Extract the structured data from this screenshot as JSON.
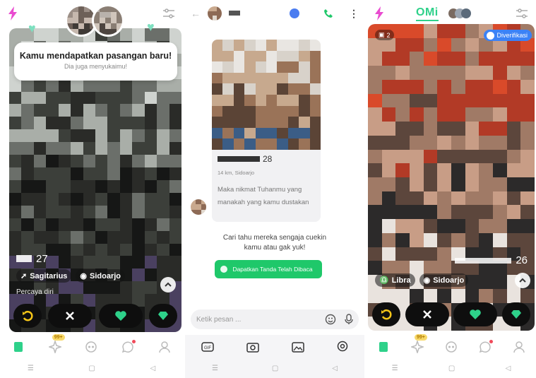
{
  "colors": {
    "accent": "#2ed18a",
    "bolt": "#e94bd0",
    "cta": "#1fc86a",
    "verified": "#3b82f6"
  },
  "screen1": {
    "match_title": "Kamu mendapatkan pasangan baru!",
    "match_subtitle": "Dia juga menyukaimu!",
    "age": "27",
    "zodiac": "Sagitarius",
    "city": "Sidoarjo",
    "bio": "Percaya diri",
    "nav_badge": "99+"
  },
  "screen2": {
    "profile_age": "28",
    "profile_distance": "14 km, Sidoarjo",
    "profile_bio": "Maka nikmat Tuhanmu yang manakah yang kamu dustakan",
    "cta_text": "Cari tahu mereka sengaja cuekin kamu atau gak yuk!",
    "cta_button": "Dapatkan Tanda Telah Dibaca",
    "input_placeholder": "Ketik pesan ..."
  },
  "screen3": {
    "logo": "OMi",
    "photo_count": "2",
    "verified_label": "Diverifikasi",
    "age": "26",
    "zodiac": "Libra",
    "city": "Sidoarjo",
    "nav_badge": "99+"
  },
  "icons": {
    "undo": "undo-icon",
    "pass": "close-icon",
    "like": "heart-icon",
    "super": "diamond-icon",
    "camera": "camera-icon",
    "gallery": "image-icon",
    "location": "location-icon",
    "gif": "gif-icon",
    "emoji": "emoji-icon",
    "mic": "mic-icon",
    "back": "back-arrow-icon",
    "call": "phone-icon",
    "more": "more-icon"
  }
}
